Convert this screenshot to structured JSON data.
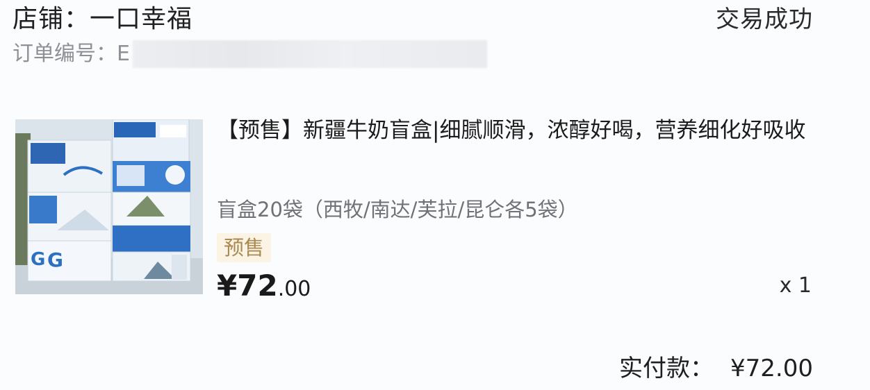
{
  "order": {
    "shop_label": "店铺：一口幸福",
    "status": "交易成功",
    "order_number_label": "订单编号：",
    "order_number_visible": "E"
  },
  "product": {
    "title": "【预售】新疆牛奶盲盒|细腻顺滑，浓醇好喝，营养细化好吸收",
    "spec": "盲盒20袋（西牧/南达/芙拉/昆仑各5袋）",
    "tag": "预售",
    "price_symbol": "¥",
    "price_int": "72",
    "price_dec": ".00",
    "quantity": "x 1"
  },
  "total": {
    "label": "实付款：",
    "amount": "¥72.00"
  },
  "colors": {
    "background": "#fbfcfe",
    "tag_text": "#a98a51",
    "tag_bg": "#fbf3e4",
    "secondary_text": "#6f7177",
    "muted_text": "#8e9096"
  }
}
